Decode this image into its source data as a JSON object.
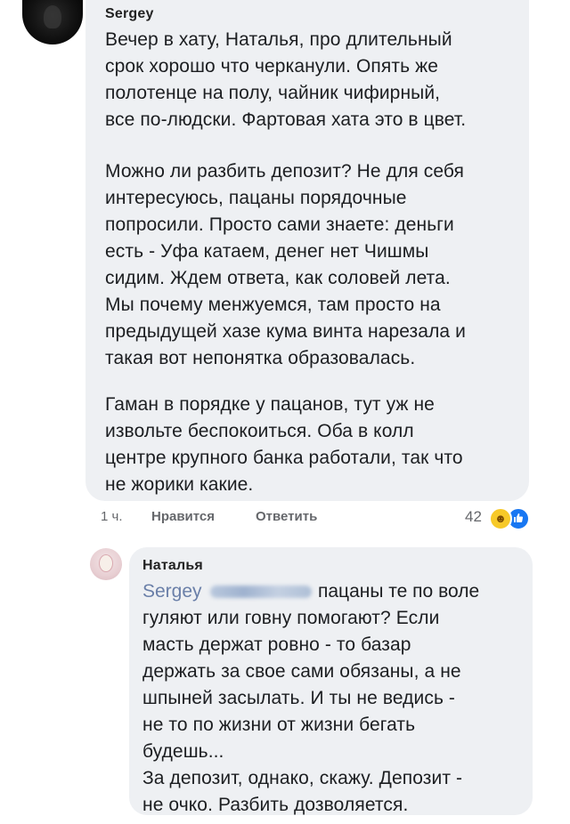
{
  "comment1": {
    "author": "Sergey",
    "paragraph1": "Вечер в хату, Наталья, про длительный\nсрок хорошо что черканули. Опять же\nполотенце на полу, чайник чифирный,\nвсе по-людски. Фартовая хата это в цвет.",
    "paragraph2": "Можно ли разбить депозит? Не для себя\nинтересуюсь, пацаны порядочные\nпопросили. Просто сами знаете: деньги\nесть - Уфа катаем, денег нет Чишмы\nсидим. Ждем ответа, как соловей лета.\nМы почему менжуемся, там просто на\nпредыдущей хазе кума винта нарезала и\nтакая вот непонятка образовалась.",
    "paragraph3": "Гаман в порядке у пацанов, тут уж не\nизвольте беспокоиться. Оба в колл\nцентре крупного банка работали, так что\nне жорики какие.",
    "time": "1 ч.",
    "like_label": "Нравится",
    "reply_label": "Ответить",
    "reaction_count": "42",
    "reaction_icons": [
      "haha-emoji",
      "like-emoji"
    ]
  },
  "comment2": {
    "author": "Наталья",
    "mention": "Sergey",
    "first_line_rest": "пацаны те по воле",
    "body": "гуляют или говну помогают? Если\nмасть держат ровно - то базар\nдержать за свое сами обязаны, а не\nшпыней засылать. И ты не ведись -\nне то по жизни от жизни бегать\nбудешь...\nЗа депозит, однако, скажу. Депозит -\nне очко. Разбить дозволяется."
  },
  "colors": {
    "bubble": "#eef0f3",
    "mention": "#6a7fa8",
    "meta": "#65676b",
    "like_blue": "#1877f2",
    "haha_yellow": "#f7c928"
  }
}
